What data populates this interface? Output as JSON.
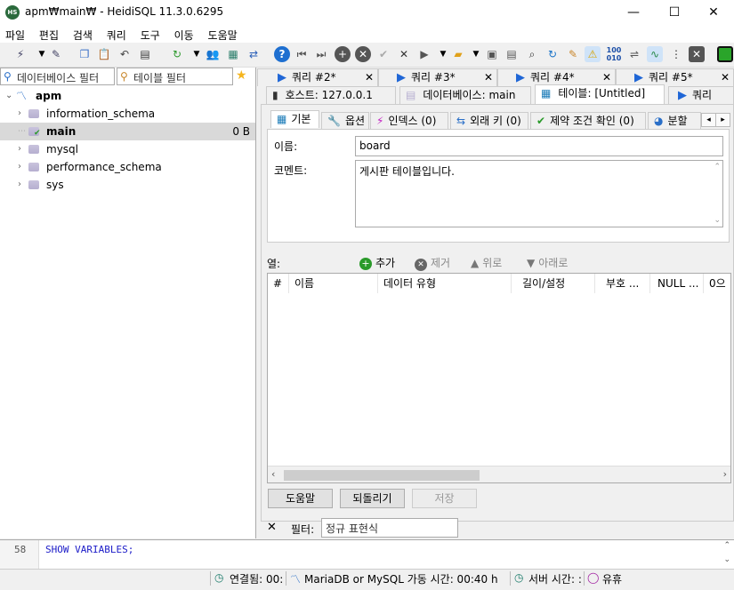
{
  "window": {
    "title": "apm₩main₩ - HeidiSQL 11.3.0.6295",
    "app_icon": "HS"
  },
  "menu": [
    "파일",
    "편집",
    "검색",
    "쿼리",
    "도구",
    "이동",
    "도움말"
  ],
  "filters": {
    "db_filter": "데이터베이스 필터",
    "table_filter": "테이블 필터"
  },
  "tree": {
    "root": "apm",
    "items": [
      {
        "name": "information_schema",
        "size": ""
      },
      {
        "name": "main",
        "size": "0 B"
      },
      {
        "name": "mysql",
        "size": ""
      },
      {
        "name": "performance_schema",
        "size": ""
      },
      {
        "name": "sys",
        "size": ""
      }
    ]
  },
  "query_tabs": [
    "쿼리 #2*",
    "쿼리 #3*",
    "쿼리 #4*",
    "쿼리 #5*"
  ],
  "main_tabs": {
    "host": "호스트: 127.0.0.1",
    "database": "데이터베이스: main",
    "table": "테이블: [Untitled]",
    "query": "쿼리"
  },
  "sub_tabs": {
    "basic": "기본",
    "options": "옵션",
    "indexes": "인덱스 (0)",
    "foreign_keys": "외래 키 (0)",
    "checks": "제약 조건 확인 (0)",
    "partitions": "분할"
  },
  "form": {
    "name_label": "이름:",
    "name_value": "board",
    "comment_label": "코멘트:",
    "comment_value": "게시판 테이블입니다."
  },
  "columns_toolbar": {
    "label": "열:",
    "add": "추가",
    "remove": "제거",
    "up": "위로",
    "down": "아래로"
  },
  "grid_headers": [
    "#",
    "이름",
    "데이터 유형",
    "길이/설정",
    "부호 ...",
    "NULL ...",
    "0으"
  ],
  "buttons": {
    "help": "도움말",
    "revert": "되돌리기",
    "save": "저장"
  },
  "filter_bar": {
    "label": "필터:",
    "placeholder": "정규 표현식"
  },
  "sql_log": {
    "line_number": "58",
    "text": "SHOW VARIABLES;"
  },
  "status": {
    "connected": "연결됨: 00:",
    "server": "MariaDB or MySQL 가동 시간: 00:40 h",
    "server_time": "서버 시간: :",
    "idle": "유휴"
  }
}
